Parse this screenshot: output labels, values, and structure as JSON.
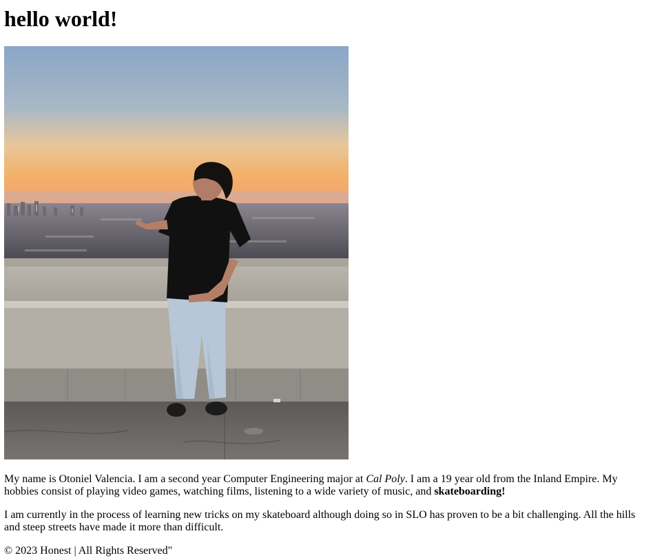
{
  "page": {
    "heading": "hello world!"
  },
  "photo": {
    "alt": "Person standing at an overlook with a city skyline at sunset"
  },
  "intro": {
    "part1": "My name is Otoniel Valencia. I am a second year Computer Engineering major at ",
    "school": "Cal Poly",
    "part2": ". I am a 19 year old from the Inland Empire. My hobbies consist of playing video games, watching films, listening to a wide variety of music, and ",
    "hobby_emphasis": "skateboarding!"
  },
  "skate": {
    "text": "I am currently in the process of learning new tricks on my skateboard although doing so in SLO has proven to be a bit challenging. All the hills and steep streets have made it more than difficult."
  },
  "footer": {
    "text": "© 2023 Honest | All Rights Reserved\""
  }
}
